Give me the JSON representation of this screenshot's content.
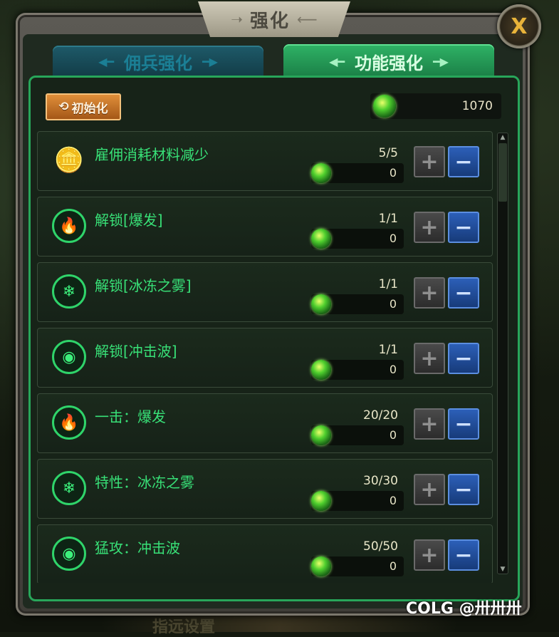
{
  "window": {
    "title": "强化",
    "close_label": "X"
  },
  "tabs": [
    {
      "label": "佣兵强化",
      "active": false
    },
    {
      "label": "功能强化",
      "active": true
    }
  ],
  "reset_button": {
    "label": "初始化"
  },
  "currency": {
    "amount": "1070",
    "icon": "green-frog-orb-icon"
  },
  "upgrades": [
    {
      "name": "雇佣消耗材料减少",
      "level": "5/5",
      "cost": "0",
      "icon": "coin-stack-icon"
    },
    {
      "name": "解锁[爆发]",
      "level": "1/1",
      "cost": "0",
      "icon": "burst-lock-icon"
    },
    {
      "name": "解锁[冰冻之雾]",
      "level": "1/1",
      "cost": "0",
      "icon": "frost-lock-icon"
    },
    {
      "name": "解锁[冲击波]",
      "level": "1/1",
      "cost": "0",
      "icon": "shockwave-lock-icon"
    },
    {
      "name": "一击：爆发",
      "level": "20/20",
      "cost": "0",
      "icon": "burst-icon"
    },
    {
      "name": "特性：冰冻之雾",
      "level": "30/30",
      "cost": "0",
      "icon": "frost-icon"
    },
    {
      "name": "猛攻：冲击波",
      "level": "50/50",
      "cost": "0",
      "icon": "shockwave-icon"
    }
  ],
  "buttons": {
    "plus": "+",
    "minus": "−"
  },
  "bottom_hint": "指远设置",
  "watermark": "COLG @卅卅卅",
  "colors": {
    "accent": "#28a65a",
    "text_green": "#38e077",
    "minus_blue": "#2c5fb8",
    "reset_orange": "#e08f3a"
  }
}
